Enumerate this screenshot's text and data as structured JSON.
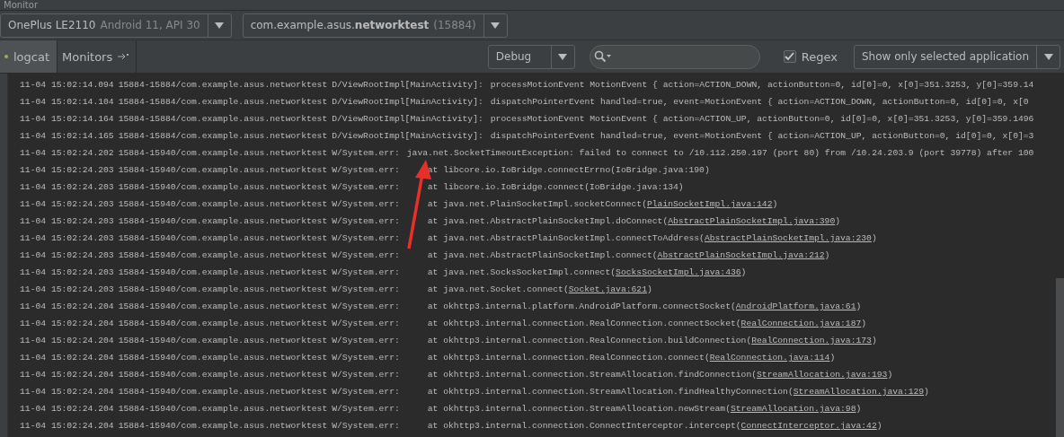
{
  "panel_title": "Monitor",
  "device": {
    "name": "OnePlus LE2110",
    "detail": "Android 11, API 30"
  },
  "app": {
    "package": "com.example.asus.**networktest**",
    "pid": "(15884)"
  },
  "tabs": [
    {
      "label": "logcat",
      "selected": true
    },
    {
      "label": "Monitors",
      "selected": false
    }
  ],
  "log_level": "Debug",
  "search": {
    "regex": true,
    "regex_label": "Regex"
  },
  "filter": "Show only selected application",
  "log": [
    {
      "time": "11-04 15:02:14.094",
      "process": "15884-15884/com.example.asus.networktest",
      "tag": "D/ViewRootImpl[MainActivity]:",
      "kind": "message",
      "message": "processMotionEvent MotionEvent { action=ACTION_DOWN, actionButton=0, id[0]=0, x[0]=351.3253, y[0]=359.14"
    },
    {
      "time": "11-04 15:02:14.104",
      "process": "15884-15884/com.example.asus.networktest",
      "tag": "D/ViewRootImpl[MainActivity]:",
      "kind": "message",
      "message": "dispatchPointerEvent handled=true, event=MotionEvent { action=ACTION_DOWN, actionButton=0, id[0]=0, x[0"
    },
    {
      "time": "11-04 15:02:14.164",
      "process": "15884-15884/com.example.asus.networktest",
      "tag": "D/ViewRootImpl[MainActivity]:",
      "kind": "message",
      "message": "processMotionEvent MotionEvent { action=ACTION_UP, actionButton=0, id[0]=0, x[0]=351.3253, y[0]=359.1496"
    },
    {
      "time": "11-04 15:02:14.165",
      "process": "15884-15884/com.example.asus.networktest",
      "tag": "D/ViewRootImpl[MainActivity]:",
      "kind": "message",
      "message": "dispatchPointerEvent handled=true, event=MotionEvent { action=ACTION_UP, actionButton=0, id[0]=0, x[0]=3"
    },
    {
      "time": "11-04 15:02:24.202",
      "process": "15884-15940/com.example.asus.networktest",
      "tag": "W/System.err:",
      "kind": "message",
      "message": "java.net.SocketTimeoutException: failed to connect to /10.112.250.197 (port 80) from /10.24.203.9 (port 39778) after 100"
    },
    {
      "time": "11-04 15:02:24.203",
      "process": "15884-15940/com.example.asus.networktest",
      "tag": "W/System.err:",
      "kind": "frame",
      "message": "at libcore.io.IoBridge.connectErrno(IoBridge.java:190)"
    },
    {
      "time": "11-04 15:02:24.203",
      "process": "15884-15940/com.example.asus.networktest",
      "tag": "W/System.err:",
      "kind": "frame",
      "message": "at libcore.io.IoBridge.connect(IoBridge.java:134)"
    },
    {
      "time": "11-04 15:02:24.203",
      "process": "15884-15940/com.example.asus.networktest",
      "tag": "W/System.err:",
      "kind": "frame",
      "message": "at java.net.PlainSocketImpl.socketConnect(",
      "link": "PlainSocketImpl.java:142",
      "tail": ")"
    },
    {
      "time": "11-04 15:02:24.203",
      "process": "15884-15940/com.example.asus.networktest",
      "tag": "W/System.err:",
      "kind": "frame",
      "message": "at java.net.AbstractPlainSocketImpl.doConnect(",
      "link": "AbstractPlainSocketImpl.java:390",
      "tail": ")"
    },
    {
      "time": "11-04 15:02:24.203",
      "process": "15884-15940/com.example.asus.networktest",
      "tag": "W/System.err:",
      "kind": "frame",
      "message": "at java.net.AbstractPlainSocketImpl.connectToAddress(",
      "link": "AbstractPlainSocketImpl.java:230",
      "tail": ")"
    },
    {
      "time": "11-04 15:02:24.203",
      "process": "15884-15940/com.example.asus.networktest",
      "tag": "W/System.err:",
      "kind": "frame",
      "message": "at java.net.AbstractPlainSocketImpl.connect(",
      "link": "AbstractPlainSocketImpl.java:212",
      "tail": ")"
    },
    {
      "time": "11-04 15:02:24.203",
      "process": "15884-15940/com.example.asus.networktest",
      "tag": "W/System.err:",
      "kind": "frame",
      "message": "at java.net.SocksSocketImpl.connect(",
      "link": "SocksSocketImpl.java:436",
      "tail": ")"
    },
    {
      "time": "11-04 15:02:24.203",
      "process": "15884-15940/com.example.asus.networktest",
      "tag": "W/System.err:",
      "kind": "frame",
      "message": "at java.net.Socket.connect(",
      "link": "Socket.java:621",
      "tail": ")"
    },
    {
      "time": "11-04 15:02:24.204",
      "process": "15884-15940/com.example.asus.networktest",
      "tag": "W/System.err:",
      "kind": "frame",
      "message": "at okhttp3.internal.platform.AndroidPlatform.connectSocket(",
      "link": "AndroidPlatform.java:61",
      "tail": ")"
    },
    {
      "time": "11-04 15:02:24.204",
      "process": "15884-15940/com.example.asus.networktest",
      "tag": "W/System.err:",
      "kind": "frame",
      "message": "at okhttp3.internal.connection.RealConnection.connectSocket(",
      "link": "RealConnection.java:187",
      "tail": ")"
    },
    {
      "time": "11-04 15:02:24.204",
      "process": "15884-15940/com.example.asus.networktest",
      "tag": "W/System.err:",
      "kind": "frame",
      "message": "at okhttp3.internal.connection.RealConnection.buildConnection(",
      "link": "RealConnection.java:173",
      "tail": ")"
    },
    {
      "time": "11-04 15:02:24.204",
      "process": "15884-15940/com.example.asus.networktest",
      "tag": "W/System.err:",
      "kind": "frame",
      "message": "at okhttp3.internal.connection.RealConnection.connect(",
      "link": "RealConnection.java:114",
      "tail": ")"
    },
    {
      "time": "11-04 15:02:24.204",
      "process": "15884-15940/com.example.asus.networktest",
      "tag": "W/System.err:",
      "kind": "frame",
      "message": "at okhttp3.internal.connection.StreamAllocation.findConnection(",
      "link": "StreamAllocation.java:193",
      "tail": ")"
    },
    {
      "time": "11-04 15:02:24.204",
      "process": "15884-15940/com.example.asus.networktest",
      "tag": "W/System.err:",
      "kind": "frame",
      "message": "at okhttp3.internal.connection.StreamAllocation.findHealthyConnection(",
      "link": "StreamAllocation.java:129",
      "tail": ")"
    },
    {
      "time": "11-04 15:02:24.204",
      "process": "15884-15940/com.example.asus.networktest",
      "tag": "W/System.err:",
      "kind": "frame",
      "message": "at okhttp3.internal.connection.StreamAllocation.newStream(",
      "link": "StreamAllocation.java:98",
      "tail": ")"
    },
    {
      "time": "11-04 15:02:24.204",
      "process": "15884-15940/com.example.asus.networktest",
      "tag": "W/System.err:",
      "kind": "frame",
      "message": "at okhttp3.internal.connection.ConnectInterceptor.intercept(",
      "link": "ConnectInterceptor.java:42",
      "tail": ")"
    }
  ]
}
